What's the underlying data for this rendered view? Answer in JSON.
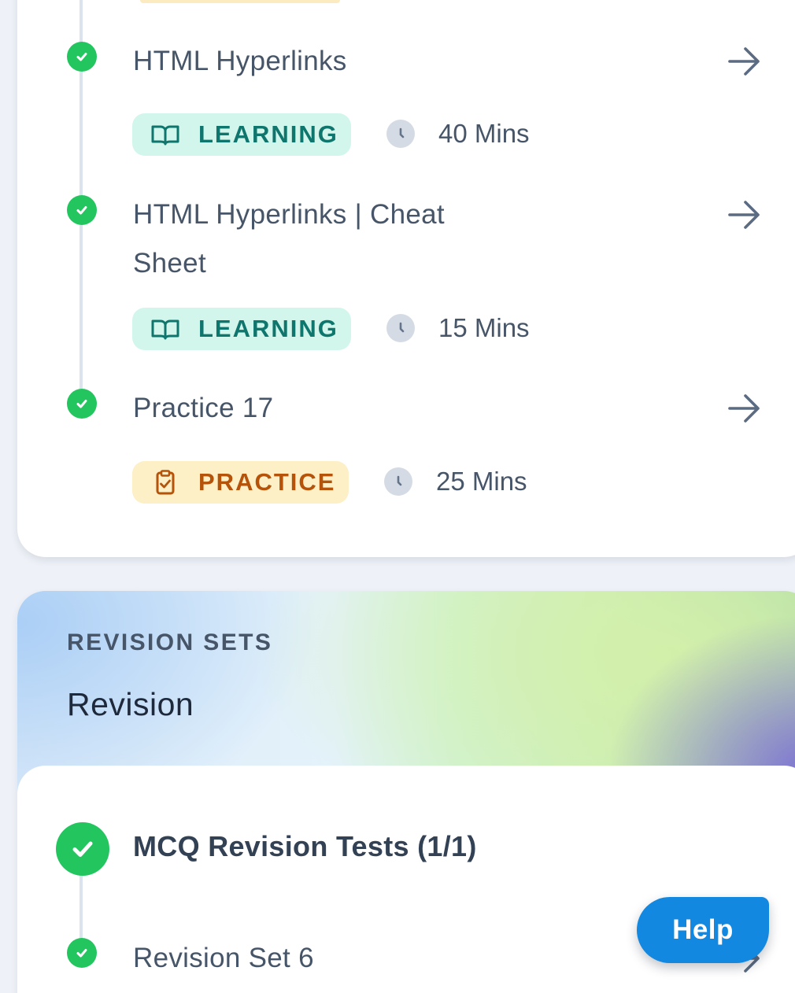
{
  "lessons": [
    {
      "title": "HTML Hyperlinks",
      "badge": "LEARNING",
      "badge_icon": "book-icon",
      "duration": "40 Mins",
      "completed": true
    },
    {
      "title_line1": "HTML Hyperlinks | Cheat",
      "title_line2": "Sheet",
      "badge": "LEARNING",
      "badge_icon": "book-icon",
      "duration": "15 Mins",
      "completed": true
    },
    {
      "title": "Practice 17",
      "badge": "PRACTICE",
      "badge_icon": "clipboard-check-icon",
      "duration": "25 Mins",
      "completed": true
    }
  ],
  "revision": {
    "section_label": "REVISION SETS",
    "title": "Revision",
    "group_title": "MCQ Revision Tests (1/1)",
    "items": [
      {
        "title": "Revision Set 6",
        "completed": true
      }
    ]
  },
  "help": {
    "label": "Help"
  },
  "colors": {
    "complete": "#22c55e",
    "learning_bg": "#d2f6ec",
    "learning_text": "#0f766e",
    "practice_bg": "#fdefc6",
    "practice_text": "#b45309",
    "help_bg": "#1388e0"
  }
}
